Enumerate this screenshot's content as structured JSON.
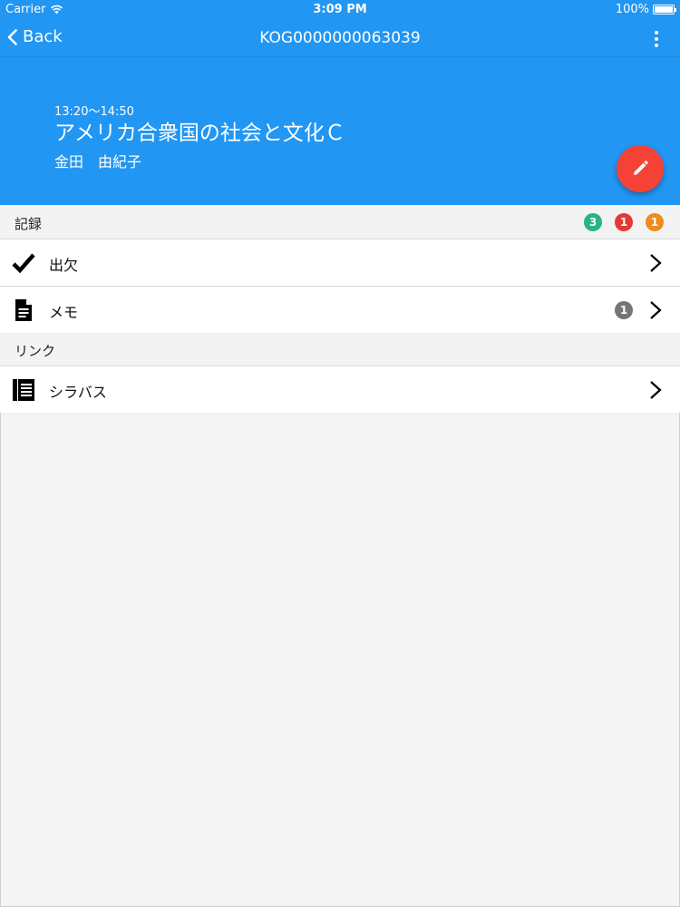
{
  "status": {
    "carrier": "Carrier",
    "time": "3:09 PM",
    "battery": "100%",
    "battery_level": 1.0
  },
  "nav": {
    "back_label": "Back",
    "title": "KOG0000000063039"
  },
  "course": {
    "time": "13:20〜14:50",
    "title": "アメリカ合衆国の社会と文化Ｃ",
    "teacher": "金田　由紀子"
  },
  "records": {
    "label": "記録",
    "badges": [
      {
        "value": "3",
        "color": "#26b38a"
      },
      {
        "value": "1",
        "color": "#e53935"
      },
      {
        "value": "1",
        "color": "#ef8a1c"
      }
    ],
    "items": [
      {
        "label": "出欠",
        "icon": "checkmark-icon"
      },
      {
        "label": "メモ",
        "icon": "document-icon",
        "count": "1"
      }
    ]
  },
  "links": {
    "label": "リンク",
    "items": [
      {
        "label": "シラバス",
        "icon": "syllabus-icon"
      }
    ]
  },
  "colors": {
    "primary": "#2196f3",
    "accent": "#f44336"
  }
}
